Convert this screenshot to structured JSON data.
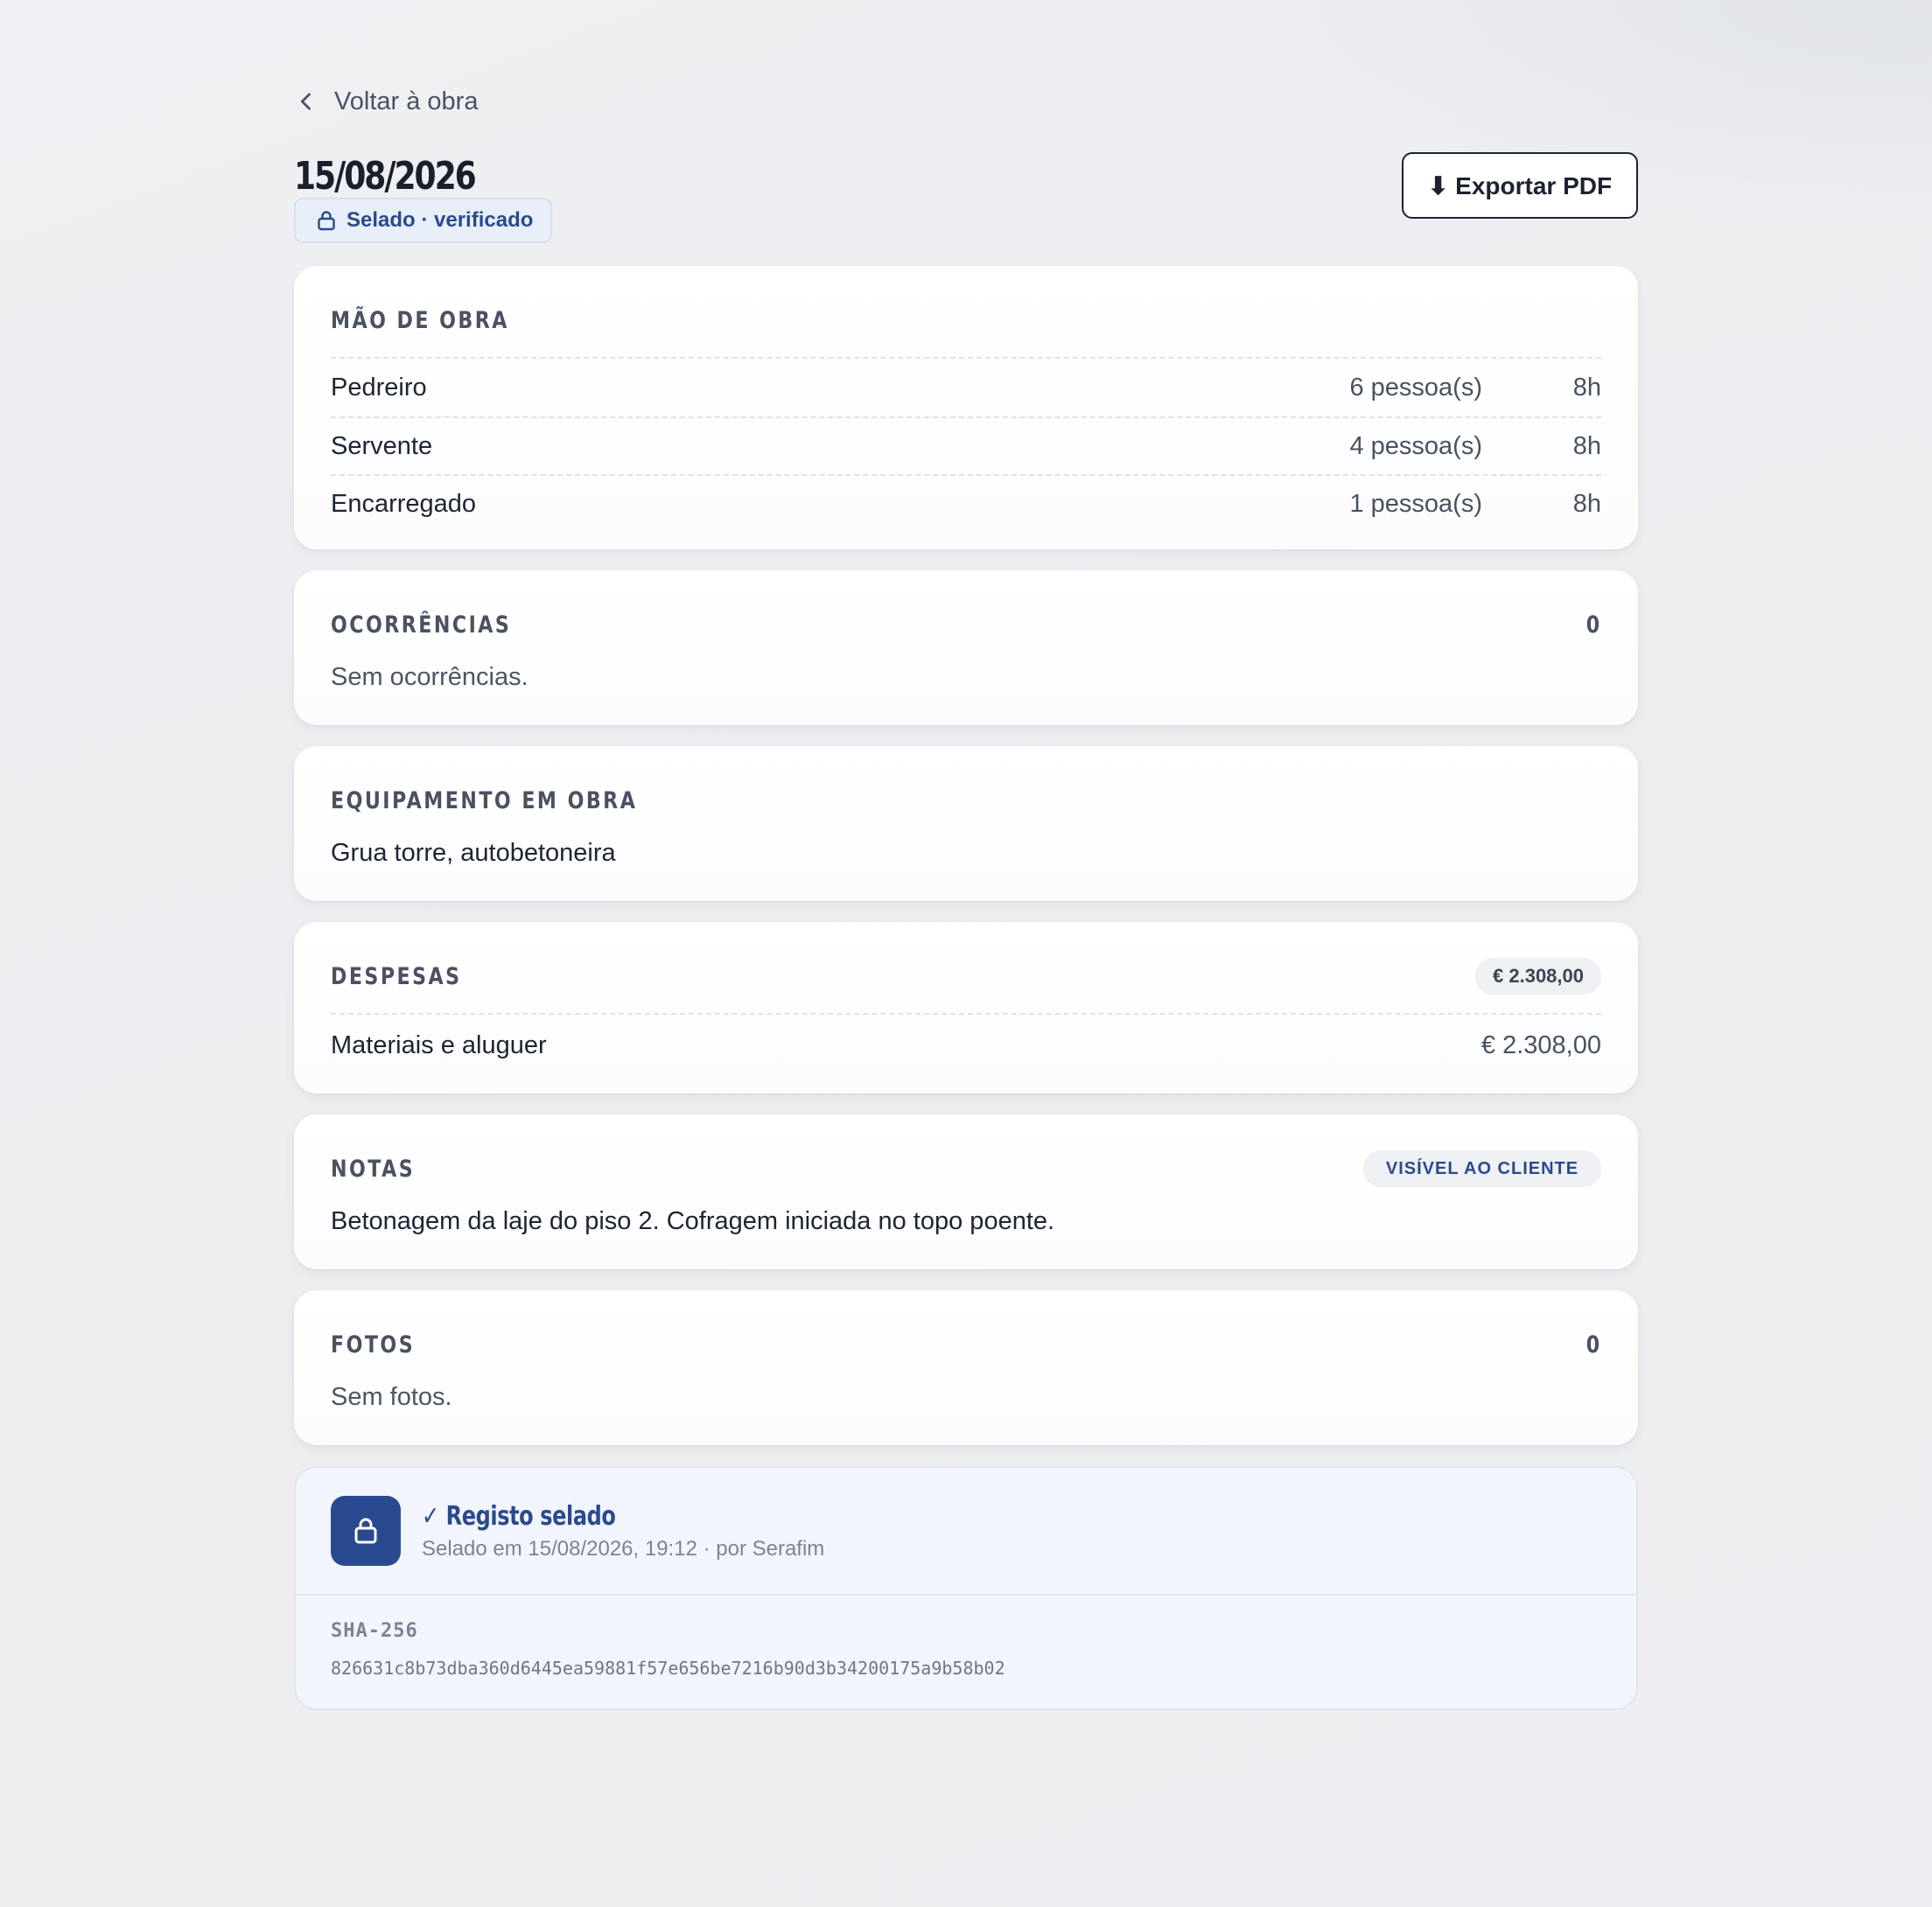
{
  "nav": {
    "back_label": "Voltar à obra"
  },
  "header": {
    "date": "15/08/2026",
    "badge": "Selado · verificado",
    "export_label": "⬇ Exportar PDF"
  },
  "labor": {
    "title": "MÃO DE OBRA",
    "rows": [
      {
        "role": "Pedreiro",
        "people": "6 pessoa(s)",
        "hours": "8h"
      },
      {
        "role": "Servente",
        "people": "4 pessoa(s)",
        "hours": "8h"
      },
      {
        "role": "Encarregado",
        "people": "1 pessoa(s)",
        "hours": "8h"
      }
    ]
  },
  "occurrences": {
    "title": "OCORRÊNCIAS",
    "count": "0",
    "empty": "Sem ocorrências."
  },
  "equipment": {
    "title": "EQUIPAMENTO EM OBRA",
    "text": "Grua torre, autobetoneira"
  },
  "expenses": {
    "title": "DESPESAS",
    "total": "€ 2.308,00",
    "rows": [
      {
        "label": "Materiais e aluguer",
        "amount": "€ 2.308,00"
      }
    ]
  },
  "notes": {
    "title": "NOTAS",
    "visibility": "VISÍVEL AO CLIENTE",
    "text": "Betonagem da laje do piso 2. Cofragem iniciada no topo poente."
  },
  "photos": {
    "title": "FOTOS",
    "count": "0",
    "empty": "Sem fotos."
  },
  "seal": {
    "title": "✓ Registo selado",
    "subtitle": "Selado em 15/08/2026, 19:12 · por Serafim",
    "hash_label": "SHA-256",
    "hash": "826631c8b73dba360d6445ea59881f57e656be7216b90d3b34200175a9b58b02"
  },
  "colors": {
    "accent": "#2a4a8f",
    "background": "#eeeff2",
    "card": "#ffffff"
  }
}
